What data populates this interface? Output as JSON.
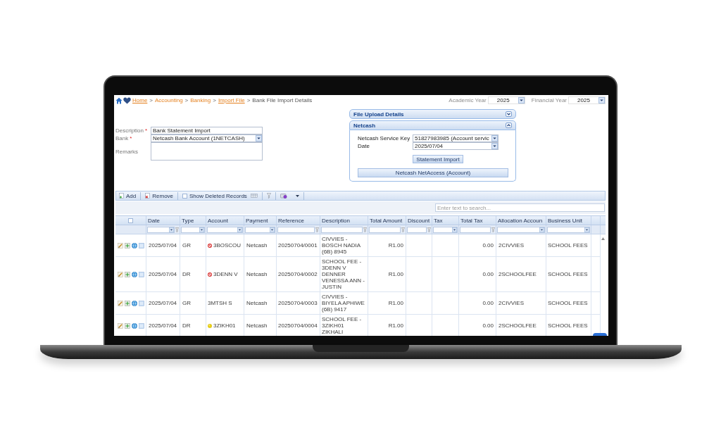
{
  "breadcrumb": {
    "items": [
      {
        "label": "Home",
        "kind": "link",
        "underlined": true
      },
      {
        "label": "Accounting",
        "kind": "link",
        "underlined": false,
        "separator": ">"
      },
      {
        "label": "Banking",
        "kind": "link",
        "underlined": false,
        "separator": ">"
      },
      {
        "label": "Import File",
        "kind": "link",
        "underlined": true,
        "separator": ">"
      },
      {
        "label": "Bank File Import Details",
        "kind": "current",
        "separator": ">"
      }
    ]
  },
  "year_selectors": [
    {
      "label": "Academic Year",
      "value": "2025"
    },
    {
      "label": "Financial Year",
      "value": "2025"
    }
  ],
  "form": {
    "fields": [
      {
        "label": "Description",
        "required_mark": "*",
        "kind": "text",
        "value": "Bank Statement Import"
      },
      {
        "label": "Bank",
        "required_mark": "*",
        "kind": "select",
        "value": "Netcash Bank Account (1NETCASH)"
      },
      {
        "label": "Remarks",
        "kind": "textarea"
      }
    ]
  },
  "panels": [
    {
      "title": "File Upload Details",
      "expanded": false
    },
    {
      "title": "Netcash",
      "expanded": true,
      "fields": [
        {
          "label": "Netcash Service Key",
          "value": "51827983985 (Account servic"
        },
        {
          "label": "Date",
          "value": "2025/07/04"
        }
      ],
      "buttons": [
        {
          "label": "Statement Import",
          "kind": "compact"
        },
        {
          "label": "Netcash NetAccess (Account)",
          "kind": "wide"
        }
      ]
    }
  ],
  "toolbar": {
    "items": [
      {
        "kind": "add",
        "label": "Add"
      },
      {
        "kind": "remove",
        "label": "Remove"
      },
      {
        "kind": "checkbox",
        "label": "Show Deleted Records",
        "checked": false
      },
      {
        "kind": "columns"
      },
      {
        "kind": "filter"
      },
      {
        "kind": "export"
      }
    ]
  },
  "search": {
    "placeholder": "Enter text to search..."
  },
  "table": {
    "select_all": {
      "checked": false
    },
    "columns": [
      {
        "label": "Date",
        "kind": "text",
        "dropdown": true,
        "filter_button": true
      },
      {
        "label": "Type",
        "kind": "text",
        "dropdown": true,
        "filter_button": false
      },
      {
        "label": "Account",
        "kind": "account",
        "dropdown": true,
        "filter_button": false
      },
      {
        "label": "Payment",
        "kind": "text",
        "dropdown": true,
        "filter_button": false
      },
      {
        "label": "Reference",
        "kind": "text",
        "dropdown": false,
        "filter_button": true
      },
      {
        "label": "Description",
        "kind": "text",
        "dropdown": false,
        "filter_button": true
      },
      {
        "label": "Total Amount",
        "kind": "amount",
        "dropdown": false,
        "filter_button": true
      },
      {
        "label": "Discount",
        "kind": "text",
        "dropdown": false,
        "filter_button": true
      },
      {
        "label": "Tax",
        "kind": "text",
        "dropdown": true,
        "filter_button": false
      },
      {
        "label": "Total Tax",
        "kind": "amount",
        "dropdown": false,
        "filter_button": true
      },
      {
        "label": "Allocation Accoun",
        "kind": "text",
        "dropdown": true,
        "filter_button": false
      },
      {
        "label": "Business Unit",
        "kind": "text",
        "dropdown": true,
        "filter_button": false
      }
    ],
    "rows": [
      {
        "kind": "blocked",
        "cells": [
          "2025/07/04",
          "GR",
          "3BOSCOU",
          "Netcash",
          "20250704/0001",
          "CIVVIES - BOSCH NADIA (6B) 8945",
          "R1.00",
          null,
          null,
          "0.00",
          "2CIVVIES",
          "SCHOOL FEES"
        ]
      },
      {
        "kind": "blocked",
        "cells": [
          "2025/07/04",
          "DR",
          "3DENN V",
          "Netcash",
          "20250704/0002",
          "SCHOOL FEE - 3DENN V DENNER VENESSA ANN - JUSTIN",
          "R1.00",
          null,
          null,
          "0.00",
          "2SCHOOLFEE",
          "SCHOOL FEES"
        ]
      },
      {
        "kind": "plain",
        "cells": [
          "2025/07/04",
          "GR",
          "3MTSH S",
          "Netcash",
          "20250704/0003",
          "CIVVIES - BIYELA APHIWE (6B) 9417",
          "R1.00",
          null,
          null,
          "0.00",
          "2CIVVIES",
          "SCHOOL FEES"
        ]
      },
      {
        "kind": "pending",
        "cells": [
          "2025/07/04",
          "DR",
          "3ZIKH01",
          "Netcash",
          "20250704/0004",
          "SCHOOL FEE - 3ZIKH01 ZIKHALI",
          "R1.00",
          null,
          null,
          "0.00",
          "2SCHOOLFEE",
          "SCHOOL FEES"
        ]
      }
    ]
  }
}
